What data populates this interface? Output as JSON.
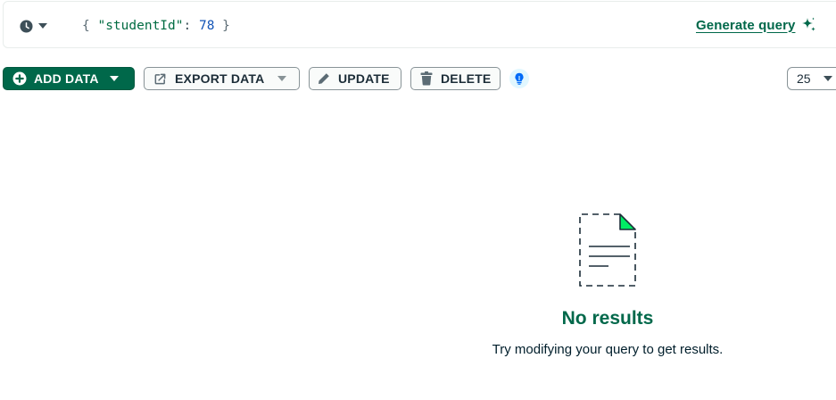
{
  "query_bar": {
    "filter": {
      "open_brace": "{",
      "key": "\"studentId\"",
      "colon": ":",
      "value": "78",
      "close_brace": "}"
    },
    "generate_query_label": "Generate query"
  },
  "toolbar": {
    "add_data_label": "ADD DATA",
    "export_data_label": "EXPORT DATA",
    "update_label": "UPDATE",
    "delete_label": "DELETE",
    "page_size_value": "25"
  },
  "empty_state": {
    "title": "No results",
    "subtitle": "Try modifying your query to get results."
  },
  "colors": {
    "brand_green": "#00684a",
    "doc_corner": "#00ed64",
    "query_key": "#016c42",
    "query_number": "#1254b7",
    "bulb_bg": "#e1f7ff",
    "bulb_icon": "#016bf8"
  },
  "icons": {
    "history": "clock-icon",
    "generate": "sparkle-icon",
    "add": "plus-circle-icon",
    "export": "export-icon",
    "update": "pencil-icon",
    "delete": "trash-icon",
    "hint": "lightbulb-icon",
    "empty": "document-icon"
  }
}
